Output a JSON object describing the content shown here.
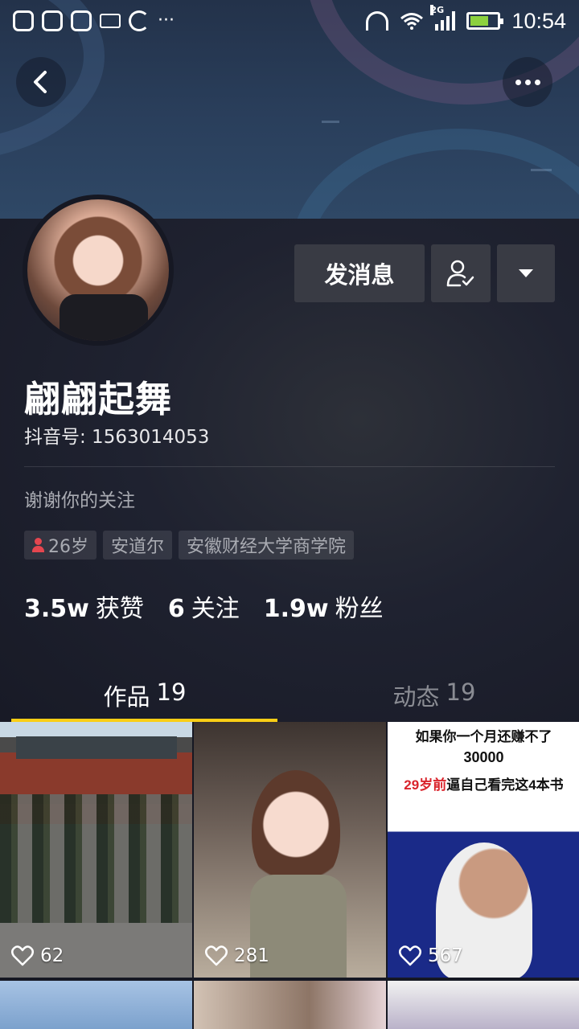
{
  "status_bar": {
    "time": "10:54",
    "network": "2G",
    "more": "···"
  },
  "header": {
    "back_icon": "chevron-left-icon",
    "more_icon": "more-dots-icon"
  },
  "profile": {
    "name": "翩翩起舞",
    "douyin_id": "抖音号: 1563014053",
    "bio": "谢谢你的关注",
    "message_button": "发消息",
    "tags": {
      "age": "26岁",
      "location": "安道尔",
      "school": "安徽财经大学商学院"
    },
    "stats": {
      "likes_value": "3.5w",
      "likes_label": "获赞",
      "following_value": "6",
      "following_label": "关注",
      "followers_value": "1.9w",
      "followers_label": "粉丝"
    }
  },
  "tabs": {
    "works_label": "作品",
    "works_count": "19",
    "moments_label": "动态",
    "moments_count": "19"
  },
  "videos": [
    {
      "likes": "62"
    },
    {
      "likes": "281"
    },
    {
      "likes": "567",
      "caption_line1": "如果你一个月还赚不了",
      "caption_line2": "30000",
      "caption_line3_red": "29岁前",
      "caption_line3": "逼自己看完这4本书"
    }
  ],
  "colors": {
    "background": "#161823",
    "accent": "#face15",
    "button": "#393b44",
    "gender_female": "#e5464f"
  }
}
